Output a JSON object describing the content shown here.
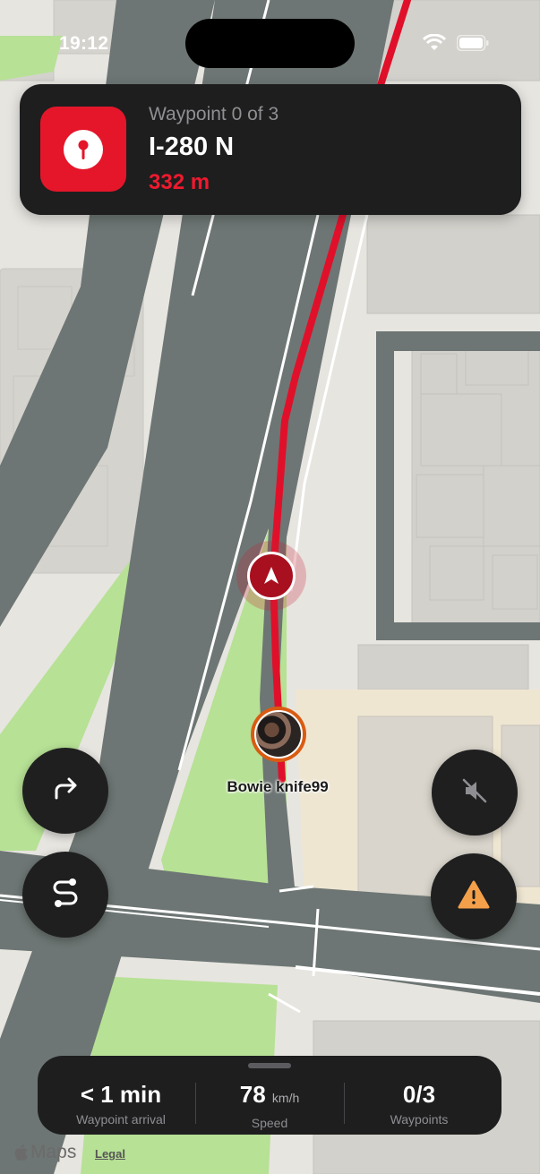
{
  "status_bar": {
    "time": "19:12"
  },
  "navigation": {
    "waypoint_progress": "Waypoint 0 of 3",
    "road": "I-280 N",
    "distance": "332 m",
    "accent": "#e5162a"
  },
  "user_marker": {
    "name": "Bowie knife99"
  },
  "controls": {
    "reroute": "arrow-turn-right-icon",
    "route": "route-icon",
    "mute": "speaker-muted-icon",
    "hazard": "warning-triangle-icon"
  },
  "stats": [
    {
      "value": "< 1 min",
      "unit": "",
      "label": "Waypoint arrival"
    },
    {
      "value": "78",
      "unit": "km/h",
      "label": "Speed"
    },
    {
      "value": "0/3",
      "unit": "",
      "label": "Waypoints"
    }
  ],
  "attribution": {
    "brand": "Maps",
    "legal": "Legal"
  }
}
